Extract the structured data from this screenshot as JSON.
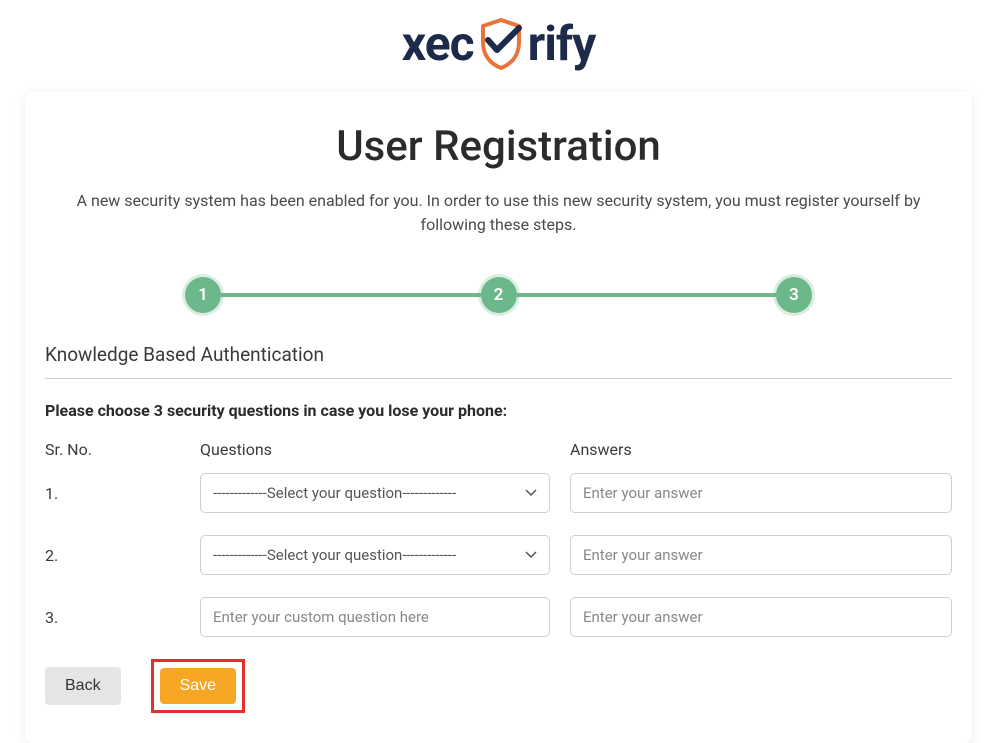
{
  "logo": {
    "text_left": "xec",
    "text_right": "rify"
  },
  "page": {
    "title": "User Registration",
    "subtitle": "A new security system has been enabled for you. In order to use this new security system, you must register yourself by following these steps."
  },
  "stepper": {
    "steps": [
      "1",
      "2",
      "3"
    ]
  },
  "section": {
    "title": "Knowledge Based Authentication",
    "instruction": "Please choose 3 security questions in case you lose your phone:"
  },
  "table": {
    "headers": {
      "sr": "Sr. No.",
      "questions": "Questions",
      "answers": "Answers"
    },
    "rows": [
      {
        "sr": "1.",
        "question_type": "select",
        "question_placeholder": "-------------Select your question-------------",
        "answer_placeholder": "Enter your answer"
      },
      {
        "sr": "2.",
        "question_type": "select",
        "question_placeholder": "-------------Select your question-------------",
        "answer_placeholder": "Enter your answer"
      },
      {
        "sr": "3.",
        "question_type": "input",
        "question_placeholder": "Enter your custom question here",
        "answer_placeholder": "Enter your answer"
      }
    ]
  },
  "buttons": {
    "back": "Back",
    "save": "Save"
  }
}
